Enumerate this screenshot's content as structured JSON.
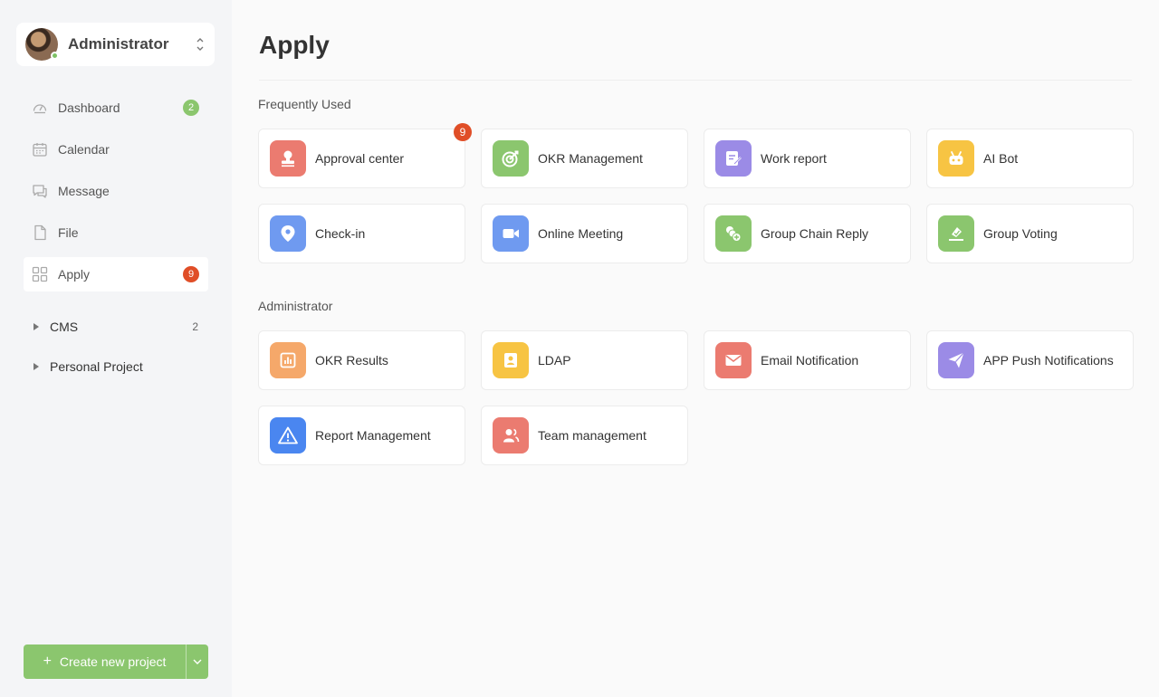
{
  "sidebar": {
    "user": {
      "name": "Administrator",
      "status": "online"
    },
    "nav": [
      {
        "label": "Dashboard",
        "icon": "dashboard-icon",
        "badge": "2",
        "badge_color": "#8bc66e"
      },
      {
        "label": "Calendar",
        "icon": "calendar-icon",
        "badge": ""
      },
      {
        "label": "Message",
        "icon": "message-icon",
        "badge": ""
      },
      {
        "label": "File",
        "icon": "file-icon",
        "badge": ""
      },
      {
        "label": "Apply",
        "icon": "apps-icon",
        "badge": "9",
        "badge_color": "#e04e27",
        "active": true
      }
    ],
    "projects": [
      {
        "label": "CMS",
        "count": "2"
      },
      {
        "label": "Personal Project",
        "count": ""
      }
    ],
    "create_button": {
      "label": "Create new project"
    }
  },
  "main": {
    "title": "Apply",
    "sections": [
      {
        "label": "Frequently Used",
        "apps": [
          {
            "label": "Approval center",
            "icon": "stamp-icon",
            "color": "#eb7b70",
            "badge": "9"
          },
          {
            "label": "OKR Management",
            "icon": "target-icon",
            "color": "#8bc66e"
          },
          {
            "label": "Work report",
            "icon": "report-edit-icon",
            "color": "#9b8be6"
          },
          {
            "label": "AI Bot",
            "icon": "robot-icon",
            "color": "#f7c443"
          },
          {
            "label": "Check-in",
            "icon": "location-pin-icon",
            "color": "#6f9af0"
          },
          {
            "label": "Online Meeting",
            "icon": "video-camera-icon",
            "color": "#6f9af0"
          },
          {
            "label": "Group Chain Reply",
            "icon": "chain-reply-icon",
            "color": "#8bc66e"
          },
          {
            "label": "Group Voting",
            "icon": "vote-icon",
            "color": "#8bc66e"
          }
        ]
      },
      {
        "label": "Administrator",
        "apps": [
          {
            "label": "OKR Results",
            "icon": "bar-chart-icon",
            "color": "#f5a86a"
          },
          {
            "label": "LDAP",
            "icon": "contact-card-icon",
            "color": "#f7c443"
          },
          {
            "label": "Email Notification",
            "icon": "mail-icon",
            "color": "#eb7b70"
          },
          {
            "label": "APP Push Notifications",
            "icon": "paper-plane-icon",
            "color": "#9b8be6"
          },
          {
            "label": "Report Management",
            "icon": "warning-icon",
            "color": "#4a86f0"
          },
          {
            "label": "Team management",
            "icon": "team-icon",
            "color": "#eb7b70"
          }
        ]
      }
    ]
  }
}
